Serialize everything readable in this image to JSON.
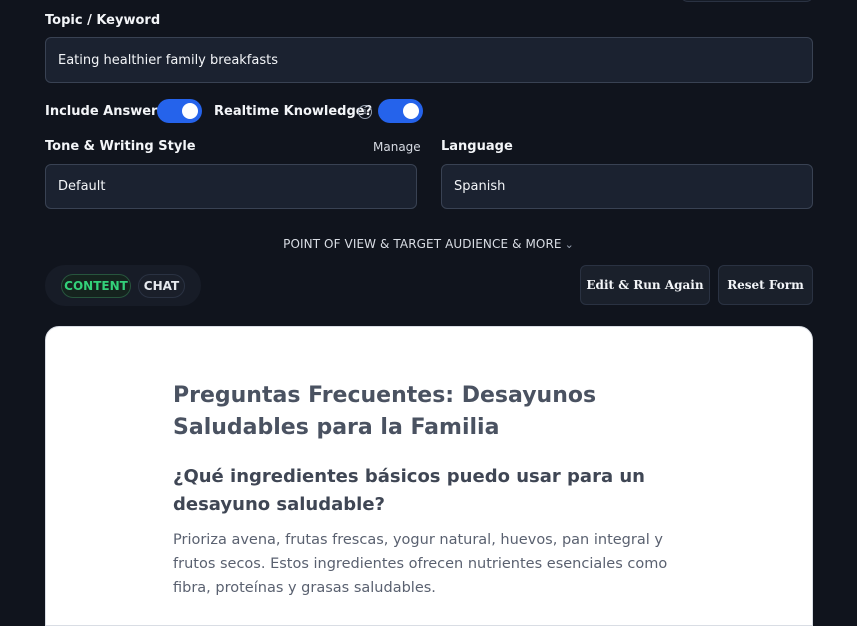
{
  "form": {
    "topic_label": "Topic / Keyword",
    "topic_value": "Eating healthier family breakfasts",
    "include_answers_label": "Include Answers?",
    "include_answers_on": true,
    "realtime_label": "Realtime Knowledge?",
    "realtime_on": true,
    "tone_label": "Tone & Writing Style",
    "manage_label": "Manage",
    "tone_value": "Default",
    "language_label": "Language",
    "language_value": "Spanish",
    "pov_label": "POINT OF VIEW & TARGET AUDIENCE & MORE"
  },
  "tabs": [
    {
      "label": "CONTENT",
      "active": true
    },
    {
      "label": "CHAT",
      "active": false
    }
  ],
  "actions": {
    "edit_run": "Edit & Run Again",
    "reset": "Reset Form"
  },
  "content": {
    "title": "Preguntas Frecuentes: Desayunos Saludables para la Familia",
    "question": "¿Qué ingredientes básicos puedo usar para un desayuno saludable?",
    "answer": "Prioriza avena, frutas frescas, yogur natural, huevos, pan integral y frutos secos. Estos ingredientes ofrecen nutrientes esenciales como fibra, proteínas y grasas saludables."
  },
  "colors": {
    "accent": "#2563eb",
    "active_tab": "#33d17a",
    "background": "#10141d"
  }
}
